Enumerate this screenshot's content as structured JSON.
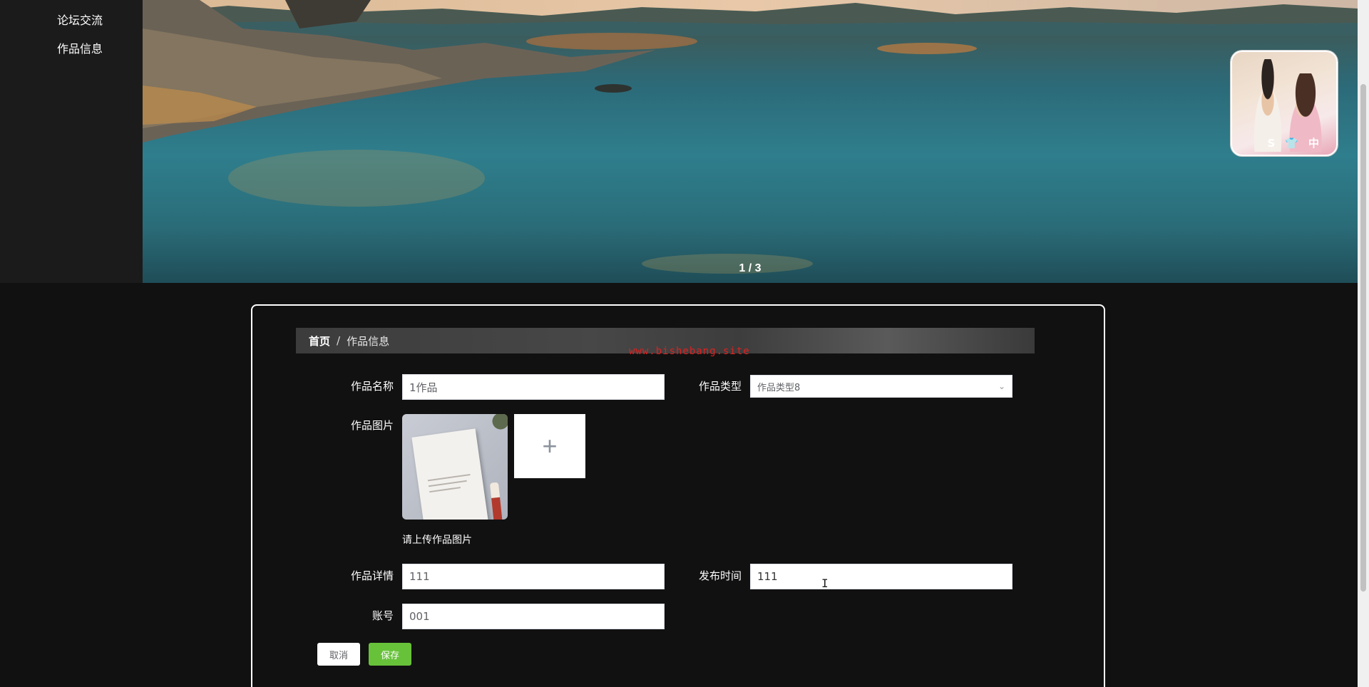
{
  "sidebar": {
    "items": [
      {
        "label": "论坛交流"
      },
      {
        "label": "作品信息"
      }
    ]
  },
  "banner": {
    "counter": "1 / 3"
  },
  "float_avatar": {
    "badges": "S👕中"
  },
  "breadcrumb": {
    "home": "首页",
    "separator": "/",
    "current": "作品信息"
  },
  "watermark": "www.bishebang.site",
  "form": {
    "name": {
      "label": "作品名称",
      "value": "1作品"
    },
    "type": {
      "label": "作品类型",
      "value": "作品类型8"
    },
    "image": {
      "label": "作品图片",
      "hint": "请上传作品图片"
    },
    "detail": {
      "label": "作品详情",
      "value": "111"
    },
    "publish_time": {
      "label": "发布时间",
      "value": "111"
    },
    "account": {
      "label": "账号",
      "value": "001"
    }
  },
  "buttons": {
    "cancel": "取消",
    "save": "保存"
  },
  "colors": {
    "page_bg": "#111111",
    "save_button": "#67c23a",
    "watermark": "#e02020"
  },
  "icons": {
    "upload_add": "plus-icon",
    "select_arrow": "chevron-down-icon"
  }
}
